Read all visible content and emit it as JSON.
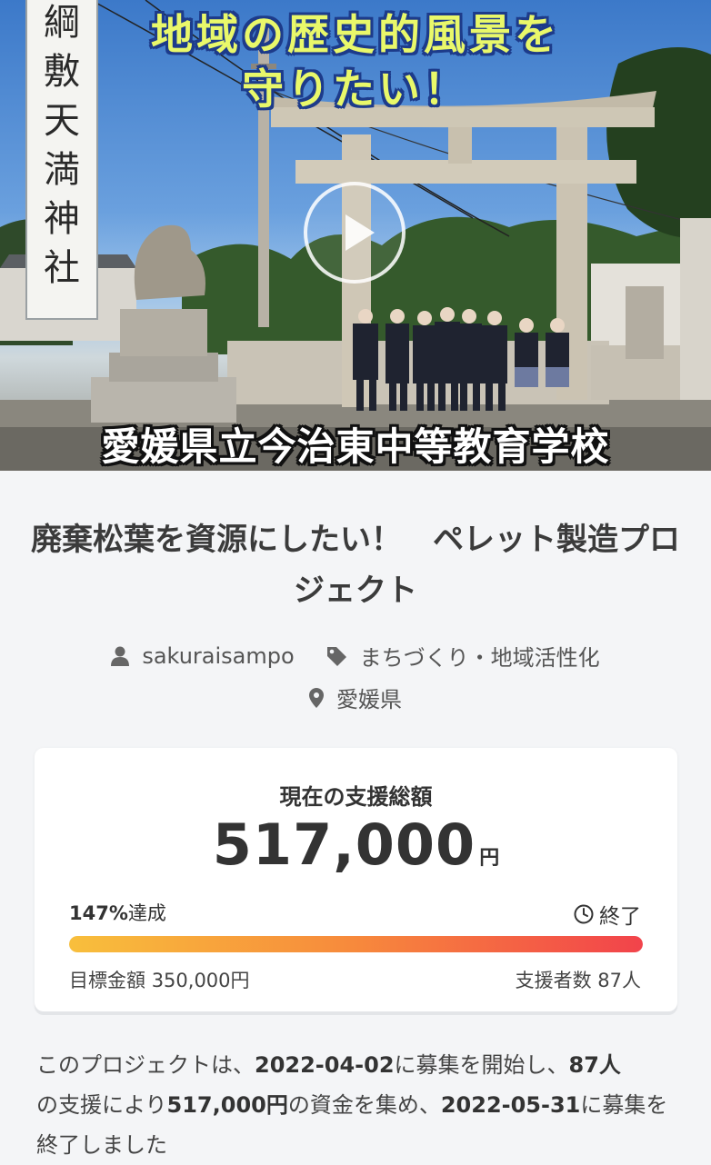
{
  "hero": {
    "headline_line1": "地域の歴史的風景を",
    "headline_line2": "守りたい！",
    "shrine_sign_chars": [
      "綱",
      "敷",
      "天",
      "満",
      "神",
      "社"
    ],
    "school_caption": "愛媛県立今治東中等教育学校"
  },
  "project": {
    "title": "廃棄松葉を資源にしたい！　ペレット製造プロジェクト",
    "author": "sakuraisampo",
    "category": "まちづくり・地域活性化",
    "location": "愛媛県"
  },
  "funding": {
    "label": "現在の支援総額",
    "amount": "517,000",
    "currency": "円",
    "achievement_pct": "147%",
    "achievement_suffix": "達成",
    "achievement_fraction": 1.0,
    "status": "終了",
    "goal_label": "目標金額",
    "goal_amount": "350,000円",
    "backers_label": "支援者数",
    "backers_count": "87人"
  },
  "description": {
    "p1": "このプロジェクトは、",
    "start_date": "2022-04-02",
    "p2": "に募集を開始し、",
    "backers": "87人",
    "p3": "の支援により",
    "total": "517,000円",
    "p4": "の資金を集め、",
    "end_date": "2022-05-31",
    "p5": "に募集を終了しました"
  },
  "colors": {
    "bar_start": "#f8bf3c",
    "bar_end": "#f2434b",
    "headline": "#e9f86a"
  }
}
